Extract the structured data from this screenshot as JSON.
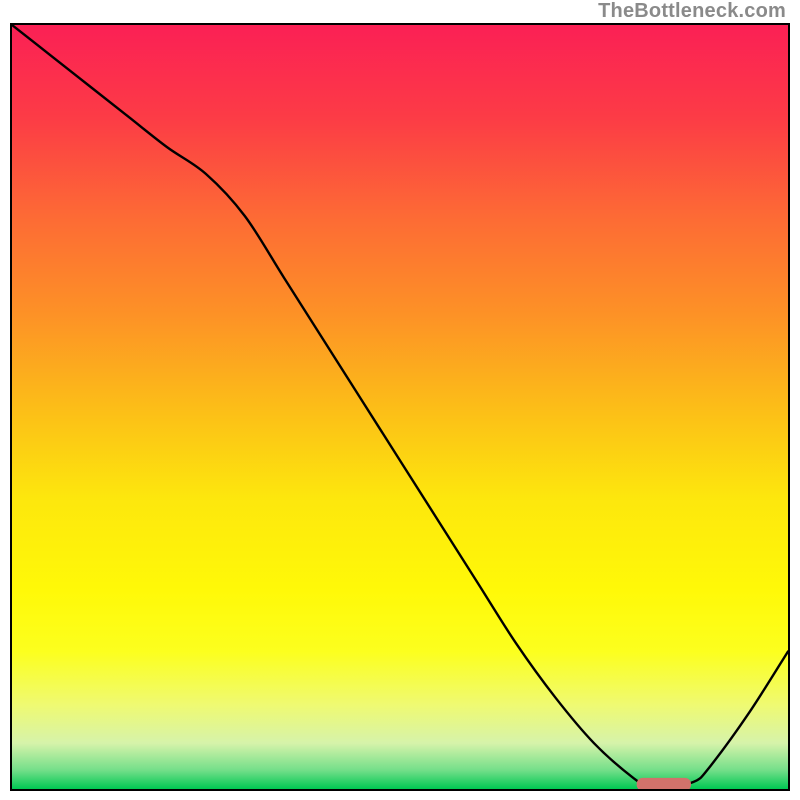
{
  "watermark": {
    "text": "TheBottleneck.com"
  },
  "chart_data": {
    "type": "line",
    "x": [
      0,
      5,
      10,
      15,
      20,
      25,
      30,
      35,
      40,
      45,
      50,
      55,
      60,
      65,
      70,
      75,
      80,
      82,
      85,
      88,
      90,
      95,
      100
    ],
    "y": [
      100,
      96,
      92,
      88,
      84,
      80.5,
      75,
      67,
      59,
      51,
      43,
      35,
      27,
      19,
      12,
      6,
      1.5,
      0.5,
      0.5,
      1,
      3,
      10,
      18
    ],
    "series": [
      {
        "name": "bottleneck-curve",
        "color": "#000000"
      }
    ],
    "marker": {
      "x_center": 84,
      "x_half_width": 3.5,
      "y": 0.6,
      "color": "#d1726b"
    },
    "xlim": [
      0,
      100
    ],
    "ylim": [
      0,
      100
    ],
    "title": "",
    "xlabel": "",
    "ylabel": "",
    "gradient_stops": [
      {
        "offset": 0.0,
        "color": "#fb2055"
      },
      {
        "offset": 0.12,
        "color": "#fc3b46"
      },
      {
        "offset": 0.25,
        "color": "#fd6a35"
      },
      {
        "offset": 0.38,
        "color": "#fd9226"
      },
      {
        "offset": 0.5,
        "color": "#fcbd18"
      },
      {
        "offset": 0.62,
        "color": "#fde70d"
      },
      {
        "offset": 0.74,
        "color": "#fff908"
      },
      {
        "offset": 0.82,
        "color": "#fcff1e"
      },
      {
        "offset": 0.89,
        "color": "#effa72"
      },
      {
        "offset": 0.94,
        "color": "#d6f3aa"
      },
      {
        "offset": 0.975,
        "color": "#75df8a"
      },
      {
        "offset": 1.0,
        "color": "#00c853"
      }
    ]
  }
}
